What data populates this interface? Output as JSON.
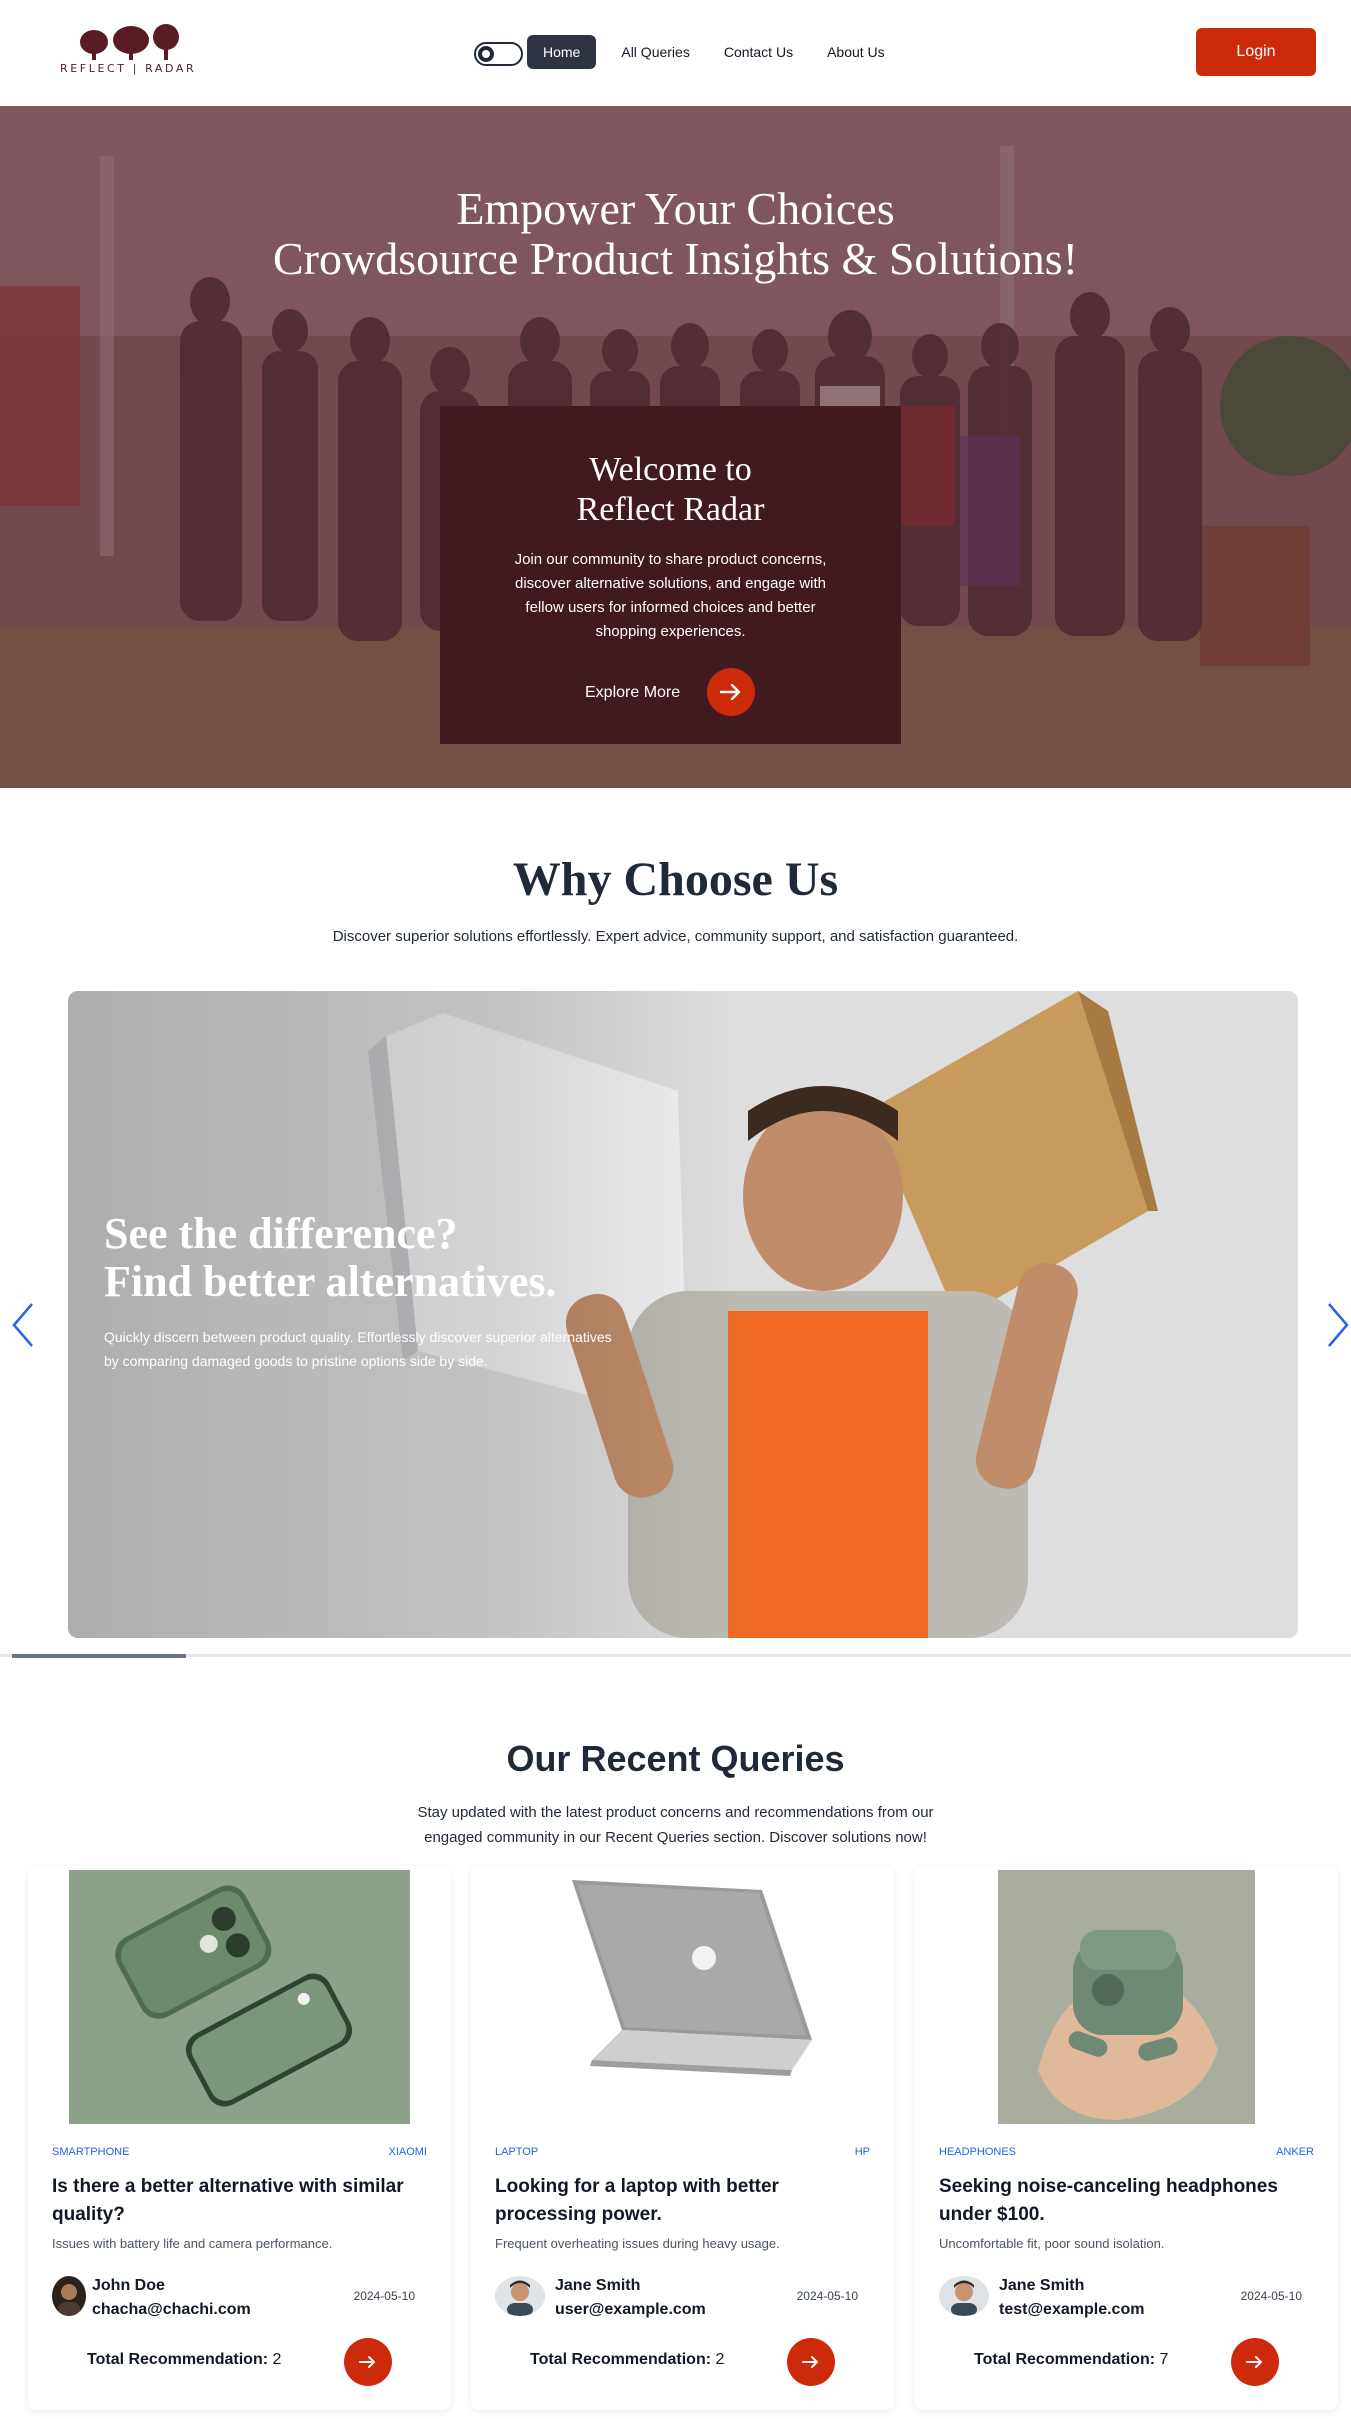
{
  "nav": {
    "logo_text": "REFLECT | RADAR",
    "links": [
      "Home",
      "All Queries",
      "Contact Us",
      "About Us"
    ],
    "login": "Login"
  },
  "hero": {
    "title_line1": "Empower Your Choices",
    "title_line2": "Crowdsource Product Insights & Solutions!",
    "card_title_line1": "Welcome to",
    "card_title_line2": "Reflect Radar",
    "card_text": "Join our community to share product concerns, discover alternative solutions, and engage with fellow users for informed choices and better shopping experiences.",
    "explore": "Explore More"
  },
  "why": {
    "title": "Why Choose Us",
    "subtitle": "Discover superior solutions effortlessly. Expert advice, community support, and satisfaction guaranteed.",
    "slide": {
      "title_line1": "See the difference?",
      "title_line2": "Find better alternatives.",
      "text": "Quickly discern between product quality. Effortlessly discover superior alternatives by comparing damaged goods to pristine options side by side."
    },
    "progress": 0.13
  },
  "recent": {
    "title": "Our Recent Queries",
    "subtitle": "Stay updated with the latest product concerns and recommendations from our engaged community in our Recent Queries section. Discover solutions now!",
    "total_label": "Total Recommendation:",
    "cards": [
      {
        "category": "SMARTPHONE",
        "brand": "XIAOMI",
        "title": "Is there a better alternative with similar quality?",
        "desc": "Issues with battery life and camera performance.",
        "user_name": "John Doe",
        "user_email": "chacha@chachi.com",
        "date": "2024-05-10",
        "total": "2"
      },
      {
        "category": "LAPTOP",
        "brand": "HP",
        "title": "Looking for a laptop with better processing power.",
        "desc": "Frequent overheating issues during heavy usage.",
        "user_name": "Jane Smith",
        "user_email": "user@example.com",
        "date": "2024-05-10",
        "total": "2"
      },
      {
        "category": "HEADPHONES",
        "brand": "ANKER",
        "title": "Seeking noise-canceling headphones under $100.",
        "desc": "Uncomfortable fit, poor sound isolation.",
        "user_name": "Jane Smith",
        "user_email": "test@example.com",
        "date": "2024-05-10",
        "total": "7"
      }
    ]
  },
  "colors": {
    "accent": "#cc2a0a",
    "hero_card": "#411a20",
    "nav_active": "#2d3340",
    "link_blue": "#2563eb"
  }
}
